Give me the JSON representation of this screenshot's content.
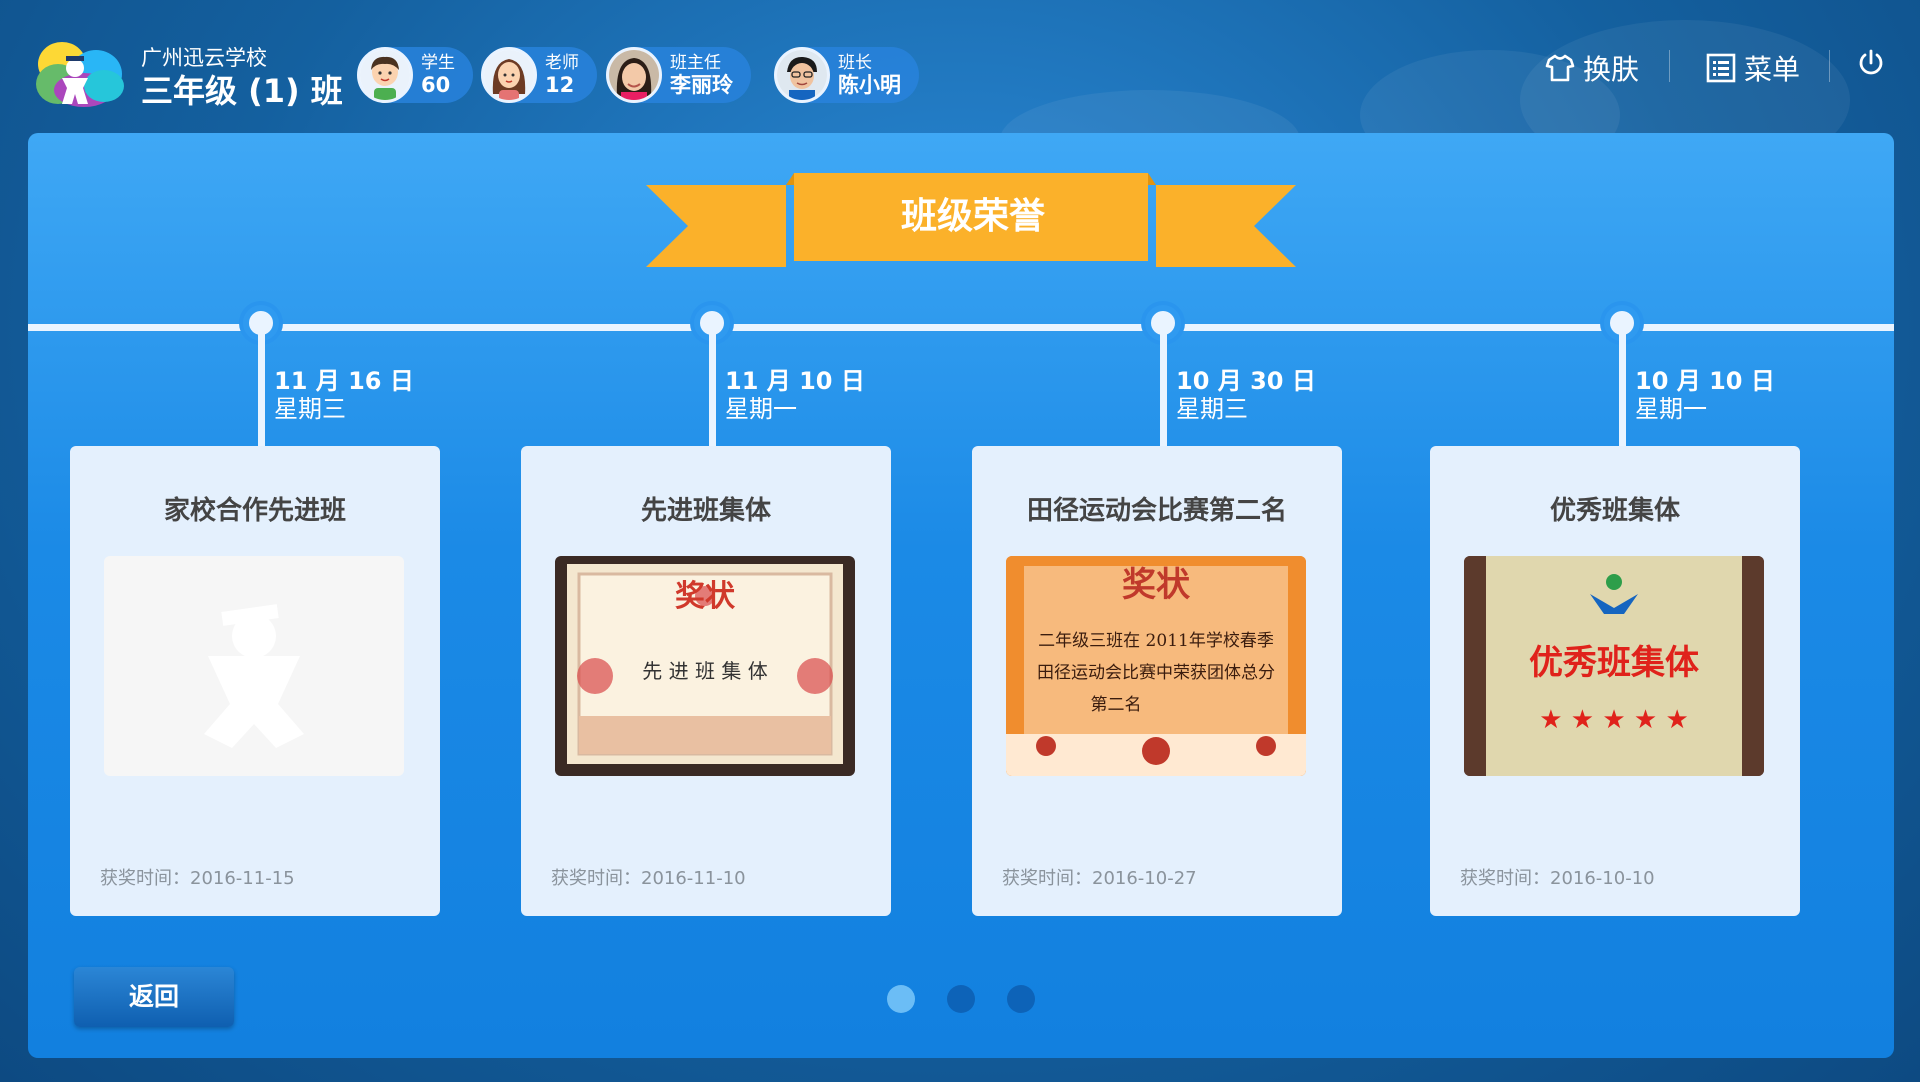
{
  "header": {
    "school": "广州迅云学校",
    "class_name": "三年级 (1) 班",
    "pills": [
      {
        "label": "学生",
        "value": "60",
        "avatar": "boy-cartoon-avatar"
      },
      {
        "label": "老师",
        "value": "12",
        "avatar": "girl-cartoon-avatar"
      },
      {
        "label": "班主任",
        "value": "李丽玲",
        "avatar": "teacher-photo-avatar"
      },
      {
        "label": "班长",
        "value": "陈小明",
        "avatar": "monitor-photo-avatar"
      }
    ],
    "actions": {
      "skin": "换肤",
      "menu": "菜单"
    }
  },
  "page": {
    "title": "班级荣誉",
    "back_label": "返回"
  },
  "timeline": [
    {
      "date": "11 月 16 日",
      "weekday": "星期三",
      "title": "家校合作先进班",
      "time": "获奖时间：2016-11-15",
      "image": "placeholder"
    },
    {
      "date": "11 月 10 日",
      "weekday": "星期一",
      "title": "先进班集体",
      "time": "获奖时间：2016-11-10",
      "image": "certificate",
      "image_text": {
        "heading": "奖状",
        "body": "先 进 班 集 体"
      }
    },
    {
      "date": "10 月 30 日",
      "weekday": "星期三",
      "title": "田径运动会比赛第二名",
      "time": "获奖时间：2016-10-27",
      "image": "certificate",
      "image_text": {
        "heading": "奖状",
        "line1": "二年级三班在 2011年学校春季",
        "line2": "田径运动会比赛中荣获团体总分",
        "line3": "第二名"
      }
    },
    {
      "date": "10 月 10 日",
      "weekday": "星期一",
      "title": "优秀班集体",
      "time": "获奖时间：2016-10-10",
      "image": "plaque",
      "image_text": {
        "body": "优秀班集体"
      }
    }
  ],
  "pagination": {
    "pages": 3,
    "current": 1
  },
  "colors": {
    "panel": "#1b8ae6",
    "ribbon": "#fbb12a",
    "card": "#e4f0fd",
    "dot_active": "#6bbdf6",
    "dot_inactive": "#0d63b8"
  }
}
